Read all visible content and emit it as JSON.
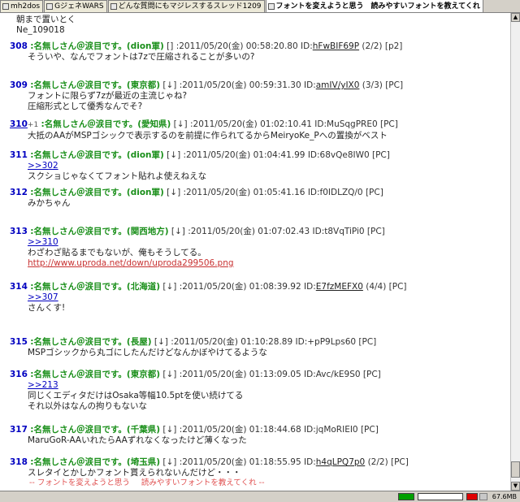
{
  "tabs": [
    {
      "label": "mh2dos"
    },
    {
      "label": "GジェネWARS"
    },
    {
      "label": "どんな質問にもマジレスするスレッド1209"
    },
    {
      "label": "フォントを変えようと思う　読みやすいフォントを教えてくれ"
    }
  ],
  "pre_lines": [
    "朝まで置いとく",
    "Ne_109018"
  ],
  "posts": [
    {
      "num": "308",
      "plus": "",
      "name": ":名無しさん＠涙目です。",
      "loc": "(dion軍)",
      "mark": "[]",
      "date": ":2011/05/20(金) 00:58:20.80",
      "id_label": "ID:",
      "id": "hFwBIF69P",
      "extra": "(2/2) [p2]",
      "lines": [
        {
          "t": "そういや、なんでフォントは7zで圧縮されることが多いの?"
        }
      ]
    },
    {
      "num": "309",
      "plus": "",
      "name": ":名無しさん＠涙目です。",
      "loc": "(東京都)",
      "mark": "[↓]",
      "date": ":2011/05/20(金) 00:59:31.30",
      "id_label": "ID:",
      "id": "amIV/yIX0",
      "extra": "(3/3) [PC]",
      "lines": [
        {
          "t": "フォントに限らず7zが最近の主流じゃね?"
        },
        {
          "t": "圧縮形式として優秀なんでそ?"
        }
      ]
    },
    {
      "num": "310",
      "plus": "+1",
      "name": ":名無しさん＠涙目です。",
      "loc": "(愛知県)",
      "mark": "[↓]",
      "date": ":2011/05/20(金) 01:02:10.41",
      "id_label": "",
      "id": "ID:MuSqgPRE0 [PC]",
      "extra": "",
      "lines": [
        {
          "t": "大抵のAAがMSPゴシックで表示するのを前提に作られてるからMeiryoKe_Pへの置換がベスト"
        }
      ]
    },
    {
      "num": "311",
      "plus": "",
      "name": ":名無しさん＠涙目です。",
      "loc": "(dion軍)",
      "mark": "[↓]",
      "date": ":2011/05/20(金) 01:04:41.99",
      "id_label": "",
      "id": "ID:68vQe8IW0 [PC]",
      "extra": "",
      "lines": [
        {
          "t": ">>302",
          "c": "anc"
        },
        {
          "t": "スクショじゃなくてフォント貼れよ使えねえな"
        }
      ]
    },
    {
      "num": "312",
      "plus": "",
      "name": ":名無しさん＠涙目です。",
      "loc": "(dion軍)",
      "mark": "[↓]",
      "date": ":2011/05/20(金) 01:05:41.16",
      "id_label": "",
      "id": "ID:f0IDLZQ/0 [PC]",
      "extra": "",
      "lines": [
        {
          "t": "みかちゃん"
        }
      ]
    },
    {
      "num": "313",
      "plus": "",
      "name": ":名無しさん＠涙目です。",
      "loc": "(関西地方)",
      "mark": "[↓]",
      "date": ":2011/05/20(金) 01:07:02.43",
      "id_label": "",
      "id": "ID:t8VqTiPi0 [PC]",
      "extra": "",
      "lines": [
        {
          "t": ">>310",
          "c": "anc"
        },
        {
          "t": "わざわざ貼るまでもないが、俺もそうしてる。"
        },
        {
          "t": "http://www.uproda.net/down/uproda299506.png",
          "c": "url"
        }
      ]
    },
    {
      "num": "314",
      "plus": "",
      "name": ":名無しさん＠涙目です。",
      "loc": "(北海道)",
      "mark": "[↓]",
      "date": ":2011/05/20(金) 01:08:39.92",
      "id_label": "ID:",
      "id": "E7fzMEFX0",
      "extra": "(4/4) [PC]",
      "lines": [
        {
          "t": ">>307",
          "c": "anc"
        },
        {
          "t": "さんくす!"
        }
      ]
    },
    {
      "num": "315",
      "plus": "",
      "name": ":名無しさん＠涙目です。",
      "loc": "(長屋)",
      "mark": "[↓]",
      "date": ":2011/05/20(金) 01:10:28.89",
      "id_label": "",
      "id": "ID:+pP9Lps60 [PC]",
      "extra": "",
      "lines": [
        {
          "t": "MSPゴシックから丸ゴにしたんだけどなんかぼやけてるような"
        }
      ]
    },
    {
      "num": "316",
      "plus": "",
      "name": ":名無しさん＠涙目です。",
      "loc": "(東京都)",
      "mark": "[↓]",
      "date": ":2011/05/20(金) 01:13:09.05",
      "id_label": "",
      "id": "ID:Avc/kE9S0 [PC]",
      "extra": "",
      "lines": [
        {
          "t": ">>213",
          "c": "anc"
        },
        {
          "t": "同じくエディタだけはOsaka等幅10.5ptを使い続けてる"
        },
        {
          "t": "それ以外はなんの拘りもないな"
        }
      ]
    },
    {
      "num": "317",
      "plus": "",
      "name": ":名無しさん＠涙目です。",
      "loc": "(千葉県)",
      "mark": "[↓]",
      "date": ":2011/05/20(金) 01:18:44.68",
      "id_label": "",
      "id": "ID:jqMoRIEI0 [PC]",
      "extra": "",
      "lines": [
        {
          "t": "MaruGoR-AAいれたらAAずれなくなったけど薄くなった"
        }
      ]
    },
    {
      "num": "318",
      "plus": "",
      "name": ":名無しさん＠涙目です。",
      "loc": "(埼玉県)",
      "mark": "[↓]",
      "date": ":2011/05/20(金) 01:18:55.95",
      "id_label": "ID:",
      "id": "h4qLPQ7p0",
      "extra": "(2/2) [PC]",
      "lines": [
        {
          "t": "スレタイとかしかフォント貰えられないんだけど・・・"
        }
      ]
    }
  ],
  "footer": [
    "-- フォントを変えようと思う",
    "読みやすいフォントを教えてくれ --"
  ],
  "status": {
    "memory": "67.6MB"
  },
  "colors": {
    "number": "#0000c0",
    "name": "#1a8f1a",
    "url": "#c83232",
    "footer": "#e05050"
  }
}
